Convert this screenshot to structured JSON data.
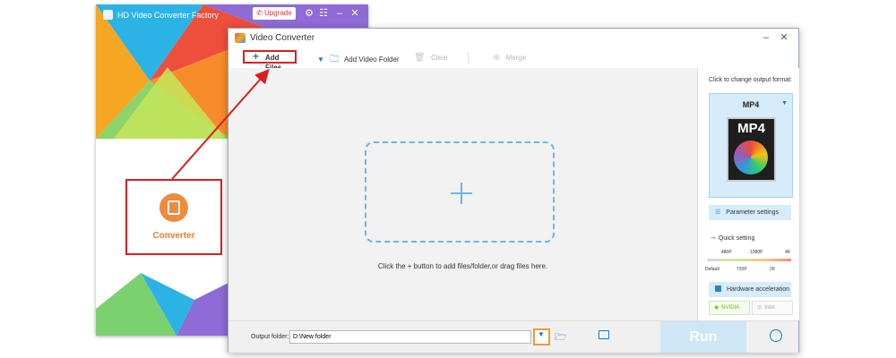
{
  "back_window": {
    "title": "HD Video Converter Factory",
    "upgrade_label": "Upgrade",
    "converter_label": "Converter"
  },
  "main_window": {
    "title": "Video Converter",
    "toolbar": {
      "add_files": "Add Files",
      "add_video_folder": "Add Video Folder",
      "clear": "Clear",
      "merge": "Merge"
    },
    "drop_hint": "Click the + button to add files/folder,or drag files here.",
    "right_panel": {
      "format_hint": "Click to change output format:",
      "format_name": "MP4",
      "thumb_label": "MP4",
      "parameter_settings": "Parameter settings",
      "quick_setting": "Quick setting",
      "quality_top": [
        "480P",
        "1080P",
        "4K"
      ],
      "quality_bottom": [
        "Default",
        "720P",
        "2K"
      ],
      "hardware_acceleration": "Hardware acceleration",
      "nvidia": "NVIDIA",
      "intel": "Intel"
    },
    "bottom": {
      "output_label": "Output folder:",
      "output_path": "D:\\New folder",
      "run_label": "Run"
    }
  },
  "colors": {
    "highlight_red": "#d91f1f",
    "highlight_orange": "#f29a2e",
    "accent_blue": "#1877d1",
    "run_button": "#cfe6f7"
  },
  "icons": [
    "film-icon",
    "plus-icon",
    "folder-icon",
    "gear-icon",
    "menu-icon",
    "minimize-icon",
    "close-icon",
    "trash-icon",
    "merge-icon",
    "alarm-icon"
  ]
}
